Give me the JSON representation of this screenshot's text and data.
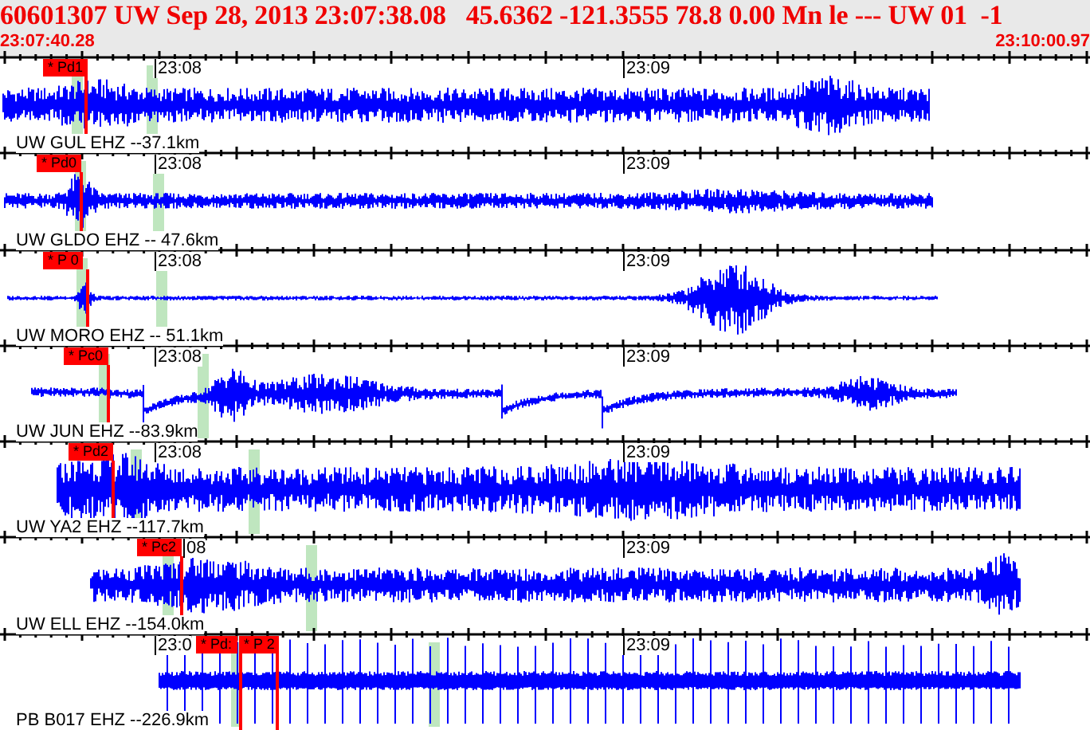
{
  "header": {
    "title": "60601307 UW Sep 28, 2013 23:07:38.08   45.6362 -121.3555 78.8 0.00 Mn le --- UW 01  -1",
    "start_time": "23:07:40.28",
    "end_time": "23:10:00.97"
  },
  "traces": [
    {
      "station": "UW GUL EHZ --37.1km",
      "time_marks": [
        "23:08",
        "23:09"
      ],
      "picks": [
        "* Pd1"
      ]
    },
    {
      "station": "UW GLDO EHZ -- 47.6km",
      "time_marks": [
        "23:08",
        "23:09"
      ],
      "picks": [
        "* Pd0"
      ]
    },
    {
      "station": "UW MORO EHZ -- 51.1km",
      "time_marks": [
        "23:08",
        "23:09"
      ],
      "picks": [
        "* P 0"
      ]
    },
    {
      "station": "UW JUN EHZ --83.9km",
      "time_marks": [
        "23:08",
        "23:09"
      ],
      "picks": [
        "* Pc0"
      ]
    },
    {
      "station": "UW YA2 EHZ --117.7km",
      "time_marks": [
        "23:08",
        "23:09"
      ],
      "picks": [
        "* Pd2"
      ]
    },
    {
      "station": "UW ELL EHZ --154.0km",
      "time_marks": [
        "08",
        "23:09"
      ],
      "picks": [
        "* Pc2"
      ]
    },
    {
      "station": "PB B017 EHZ --226.9km",
      "time_marks": [
        "23:0",
        "23:09"
      ],
      "picks": [
        "* Pd:",
        "* P 2"
      ]
    }
  ]
}
